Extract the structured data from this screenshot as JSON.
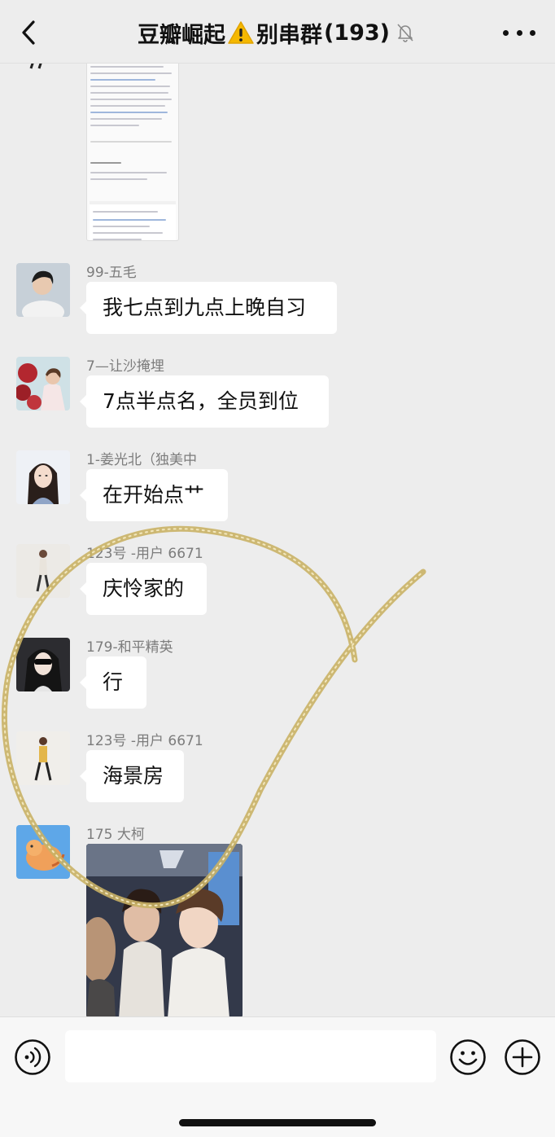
{
  "header": {
    "title_prefix": "豆瓣崛起",
    "title_suffix": "别串群",
    "member_count": "(193)",
    "icons": [
      "back-arrow-icon",
      "warning-icon",
      "muted-bell-icon",
      "more-dots-icon"
    ]
  },
  "messages": [
    {
      "sender": "99-五毛",
      "text": "我七点到九点上晚自习"
    },
    {
      "sender": "7—让沙掩埋",
      "text": "7点半点名，全员到位"
    },
    {
      "sender": "1-姜光北（独美中",
      "text": "在开始点艹"
    },
    {
      "sender": "123号 -用户 6671",
      "text": "庆怜家的"
    },
    {
      "sender": "179-和平精英",
      "text": "行"
    },
    {
      "sender": "123号 -用户 6671",
      "text": "海景房"
    },
    {
      "sender": "175 大柯",
      "text": ""
    }
  ],
  "input": {
    "value": "",
    "placeholder": ""
  },
  "colors": {
    "background": "#ededed",
    "bubble": "#ffffff",
    "scribble": "#c9b165"
  }
}
